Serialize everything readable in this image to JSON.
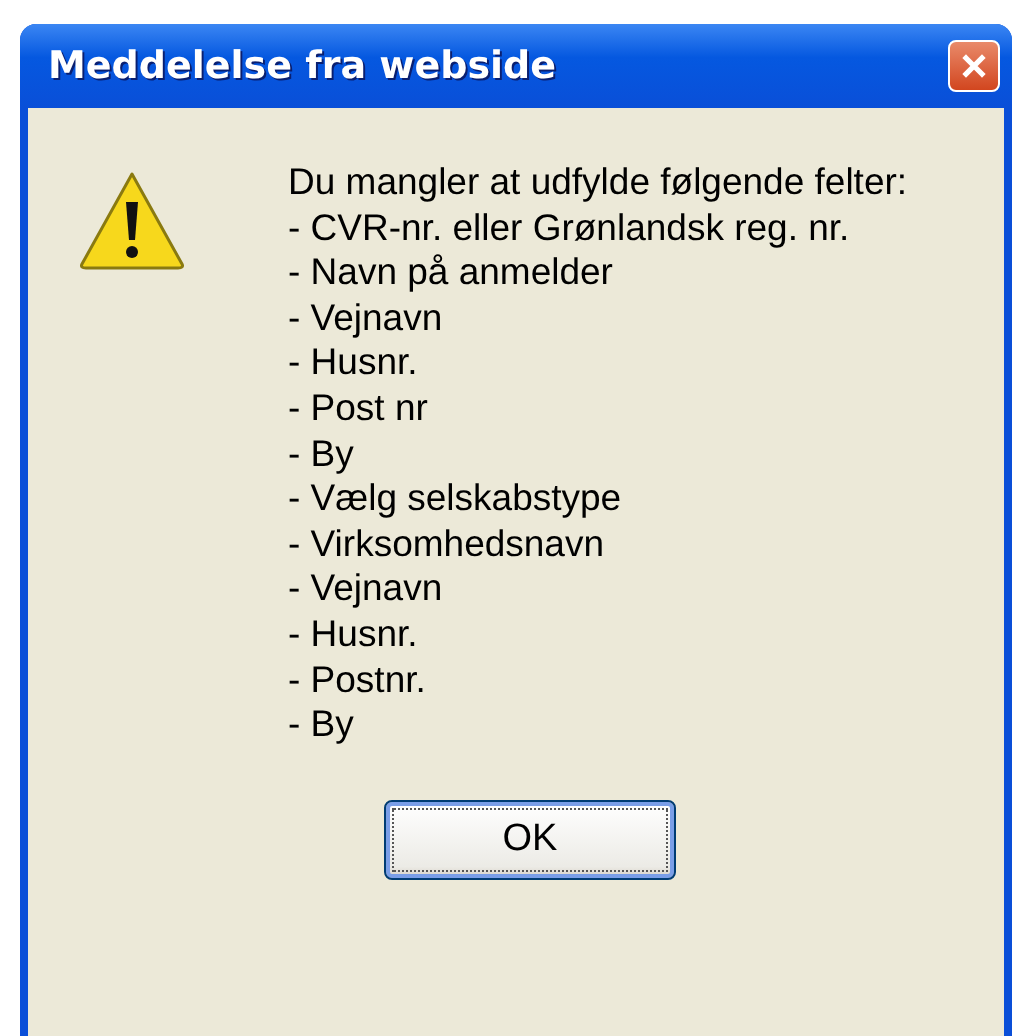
{
  "window": {
    "title": "Meddelelse fra webside"
  },
  "message": {
    "heading": "Du mangler at udfylde følgende felter:",
    "items": [
      "- CVR-nr. eller Grønlandsk reg. nr.",
      "- Navn på anmelder",
      "- Vejnavn",
      "- Husnr.",
      "- Post nr",
      "- By",
      "- Vælg selskabstype",
      "- Virksomhedsnavn",
      "- Vejnavn",
      "- Husnr.",
      "- Postnr.",
      "- By"
    ]
  },
  "buttons": [
    {
      "label": "OK",
      "kind": "default"
    }
  ]
}
